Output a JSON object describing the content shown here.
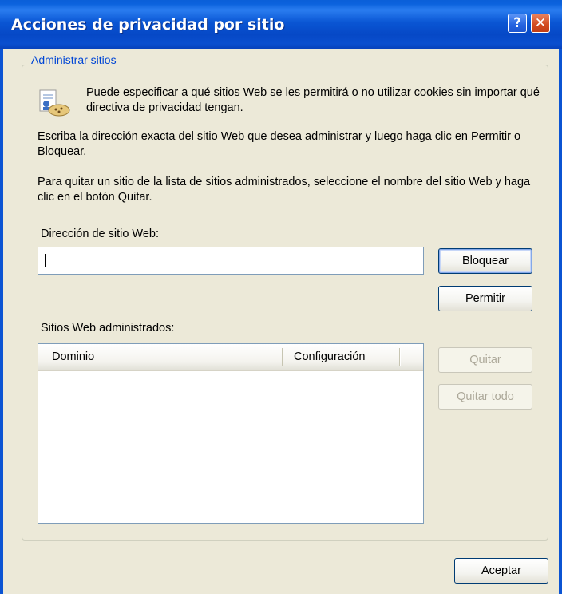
{
  "window": {
    "title": "Acciones de privacidad por sitio",
    "help_glyph": "?",
    "close_glyph": "✕"
  },
  "group": {
    "label": "Administrar sitios",
    "info_text": "Puede especificar a qué sitios Web se les permitirá o no utilizar cookies sin importar qué directiva de privacidad tengan.",
    "instruction_text": "Escriba la dirección exacta del sitio Web que desea administrar y luego haga clic en Permitir o Bloquear.",
    "remove_text": "Para quitar un sitio de la lista de sitios administrados, seleccione el nombre del sitio Web y haga clic en el botón Quitar."
  },
  "address": {
    "label": "Dirección de sitio Web:",
    "value": ""
  },
  "buttons": {
    "block": "Bloquear",
    "allow": "Permitir",
    "remove": "Quitar",
    "remove_all": "Quitar todo",
    "ok": "Aceptar"
  },
  "managed_sites": {
    "label": "Sitios Web administrados:",
    "columns": [
      "Dominio",
      "Configuración"
    ],
    "rows": []
  },
  "colors": {
    "titlebar": "#0a56d4",
    "dialog_bg": "#ece9d8",
    "group_label": "#0046d5"
  },
  "icons": {
    "info": "privacy-cookie-icon",
    "help": "help-icon",
    "close": "close-icon"
  }
}
